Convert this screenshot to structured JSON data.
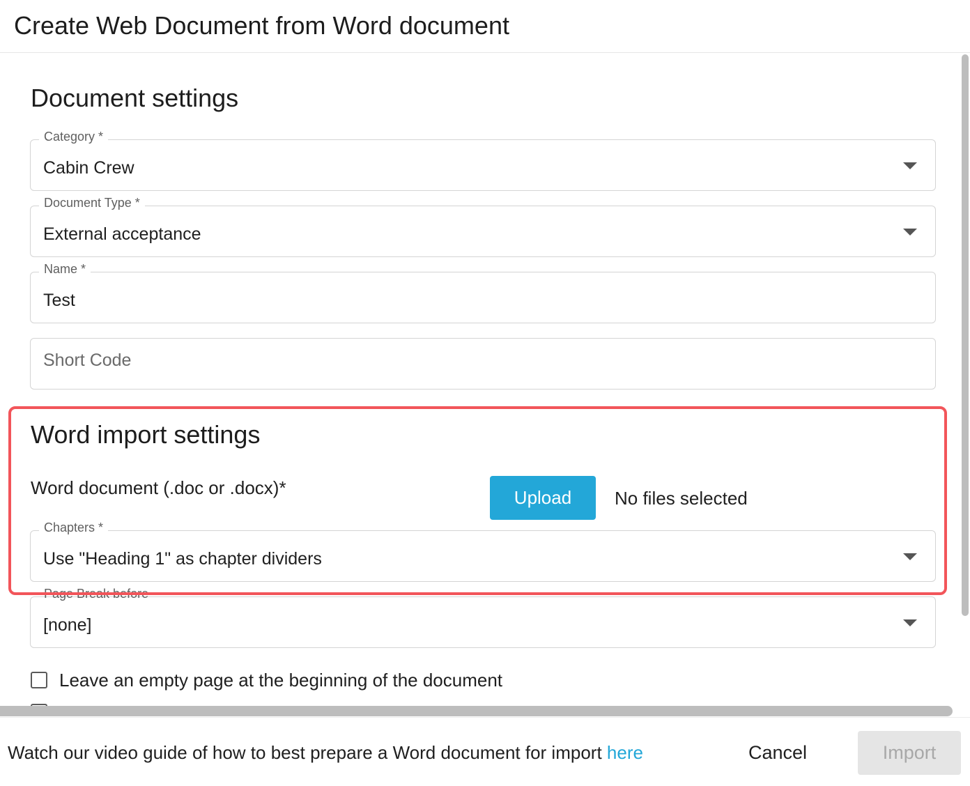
{
  "dialog": {
    "title": "Create Web Document from Word document"
  },
  "document_settings": {
    "heading": "Document settings",
    "category": {
      "label": "Category *",
      "value": "Cabin Crew"
    },
    "document_type": {
      "label": "Document Type *",
      "value": "External acceptance"
    },
    "name": {
      "label": "Name *",
      "value": "Test"
    },
    "short_code": {
      "placeholder": "Short Code",
      "value": ""
    }
  },
  "word_import_settings": {
    "heading": "Word import settings",
    "word_document_label": "Word document (.doc or .docx)*",
    "upload_label": "Upload",
    "upload_status": "No files selected",
    "chapters": {
      "label": "Chapters *",
      "value": "Use \"Heading 1\" as chapter dividers"
    },
    "page_break_before": {
      "label": "Page Break before",
      "value": "[none]"
    },
    "empty_page_checkbox": {
      "label": "Leave an empty page at the beginning of the document",
      "checked": false
    }
  },
  "footer": {
    "guide_text": "Watch our video guide of how to best prepare a Word document for import ",
    "guide_link": "here",
    "cancel_label": "Cancel",
    "import_label": "Import"
  },
  "colors": {
    "accent": "#23a7d8",
    "highlight": "#f2555a",
    "disabled_bg": "#e5e5e5",
    "disabled_text": "#a8a8a8"
  },
  "icons": {
    "dropdown": "chevron-down-icon",
    "checkbox": "checkbox-icon"
  }
}
